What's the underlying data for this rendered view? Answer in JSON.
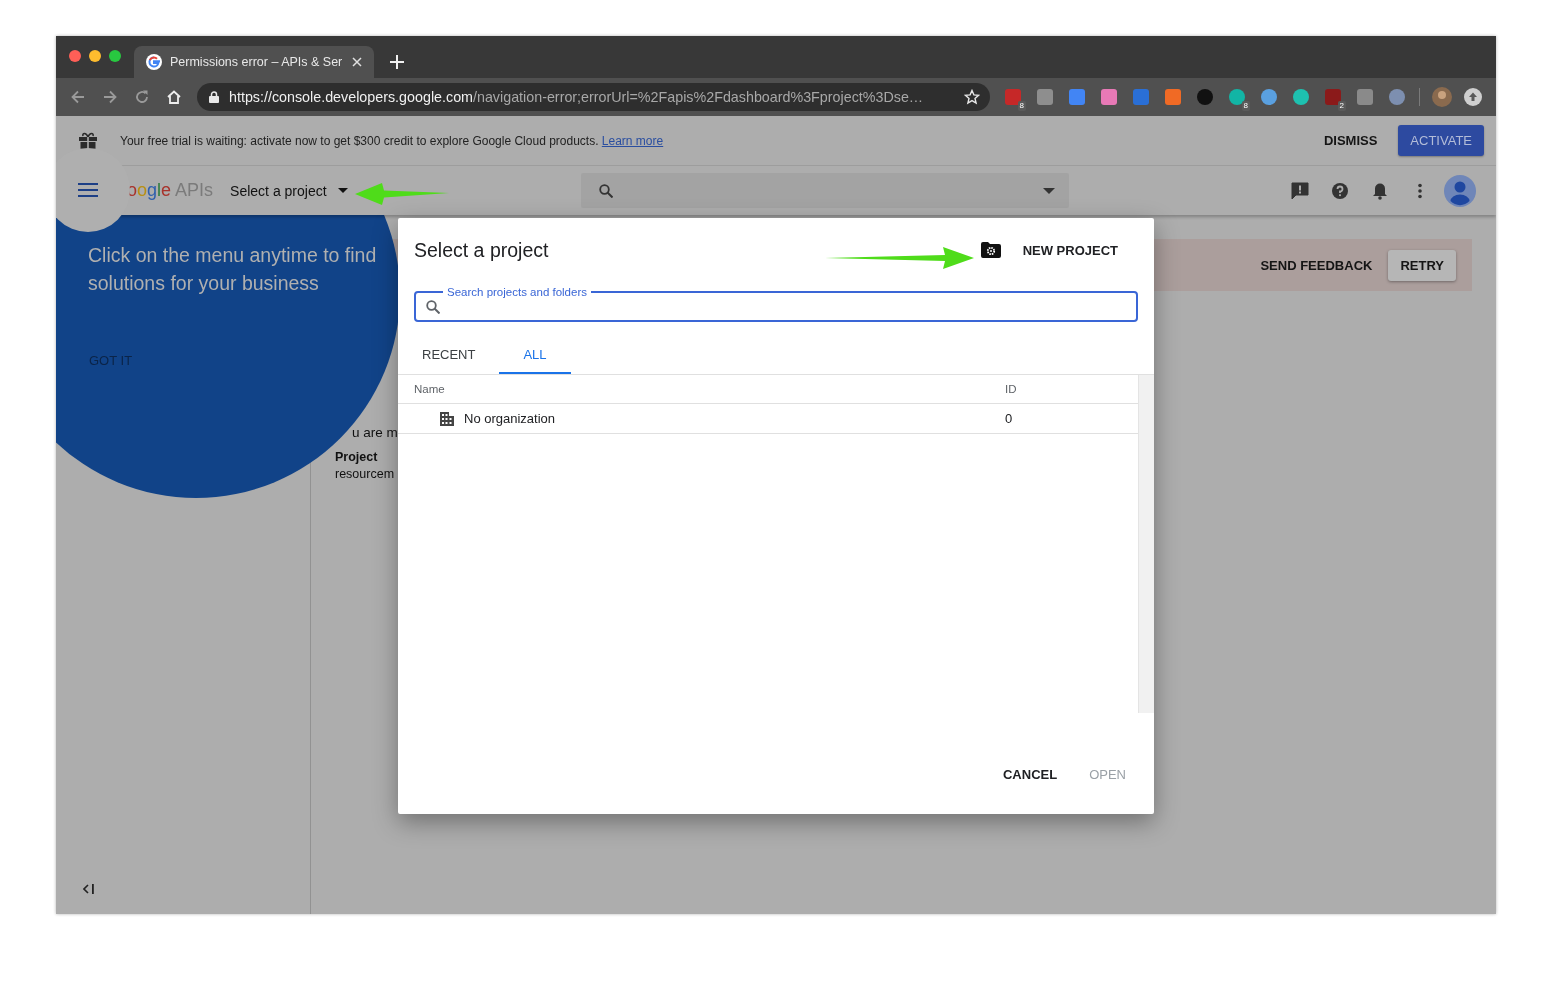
{
  "browser": {
    "tab": {
      "title": "Permissions error – APIs & Ser"
    },
    "address_bar": {
      "url_origin": "https://console.developers.google.com",
      "url_path": "/navigation-error;errorUrl=%2Fapis%2Fdashboard%3Fproject%3Dse…"
    },
    "extensions": [
      {
        "kind": "square",
        "color": "#c62828",
        "badge": "8"
      },
      {
        "kind": "square",
        "color": "#8e8e8e"
      },
      {
        "kind": "square",
        "color": "#4285f4"
      },
      {
        "kind": "square",
        "color": "#e879b6"
      },
      {
        "kind": "square",
        "color": "#2a6fd6"
      },
      {
        "kind": "square",
        "color": "#f06a25"
      },
      {
        "kind": "circle",
        "color": "#111111"
      },
      {
        "kind": "circle",
        "color": "#12b5a5",
        "badge": "8"
      },
      {
        "kind": "circle",
        "color": "#5aa0e0"
      },
      {
        "kind": "circle",
        "color": "#1ec1b0"
      },
      {
        "kind": "square",
        "color": "#8b1a1a",
        "badge": "2"
      },
      {
        "kind": "square",
        "color": "#8a8a8a"
      },
      {
        "kind": "circle",
        "color": "#7d8fb0"
      }
    ]
  },
  "trial_banner": {
    "text": "Your free trial is waiting: activate now to get $300 credit to explore Google Cloud products.",
    "link": "Learn more",
    "buttons": [
      "DISMISS",
      "ACTIVATE"
    ]
  },
  "header": {
    "logo": {
      "text": "oogle",
      "suffix": "APIs"
    },
    "project_picker": "Select a project"
  },
  "feature_highlight": {
    "title": "Click on the menu anytime to find solutions for your business",
    "button": "GOT IT"
  },
  "error_banner": {
    "buttons": [
      "SEND FEEDBACK",
      "RETRY"
    ]
  },
  "page_fragments": {
    "line": "u are m",
    "label": "Project",
    "value": "resourcem"
  },
  "dialog": {
    "title": "Select a project",
    "new_project": "NEW PROJECT",
    "search": {
      "label": "Search projects and folders"
    },
    "tabs": [
      {
        "label": "RECENT",
        "selected": false
      },
      {
        "label": "ALL",
        "selected": true
      }
    ],
    "table": {
      "columns": [
        "Name",
        "ID"
      ],
      "rows": [
        {
          "kind": "organization",
          "name": "No organization",
          "id": "0"
        }
      ]
    },
    "buttons": [
      {
        "label": "CANCEL",
        "disabled": false
      },
      {
        "label": "OPEN",
        "disabled": true
      }
    ]
  }
}
